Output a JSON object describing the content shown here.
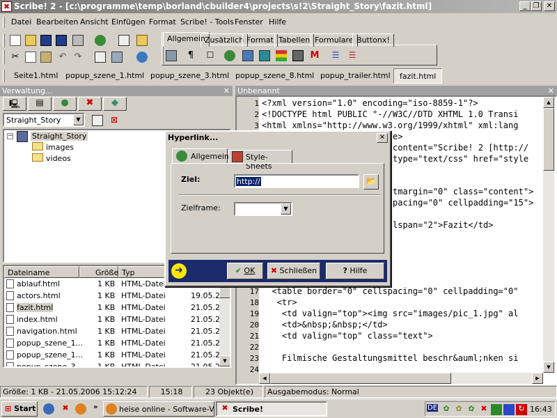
{
  "window": {
    "title": "Scribe! 2 - [c:\\programme\\temp\\borland\\cbuilder4\\projects\\s!2\\Straight_Story\\fazit.html]"
  },
  "menu": [
    "Datei",
    "Bearbeiten",
    "Ansicht",
    "Einfügen",
    "Format",
    "Scribe! - Tools",
    "Fenster",
    "Hilfe"
  ],
  "toolbar_tabs": [
    "Allgemein",
    "Zusätzlich",
    "Format",
    "Tabellen",
    "Formulare",
    "Buttonx!"
  ],
  "doc_tabs": [
    "Seite1.html",
    "popup_szene_1.html",
    "popup_szene_3.html",
    "popup_szene_8.html",
    "popup_trailer.html",
    "fazit.html"
  ],
  "left_panel": {
    "title": "Verwaltung...",
    "project_select": "Straight_Story",
    "tree": {
      "root": "Straight_Story",
      "children": [
        "images",
        "videos"
      ]
    },
    "columns": [
      "Dateiname",
      "Größe",
      "Typ"
    ],
    "files": [
      {
        "name": "ablauf.html",
        "size": "1 KB",
        "type": "HTML-Datei",
        "date": ""
      },
      {
        "name": "actors.html",
        "size": "1 KB",
        "type": "HTML-Datei",
        "date": "19.05.2"
      },
      {
        "name": "fazit.html",
        "size": "1 KB",
        "type": "HTML-Datei",
        "date": "21.05.2"
      },
      {
        "name": "index.html",
        "size": "1 KB",
        "type": "HTML-Datei",
        "date": "21.05.2"
      },
      {
        "name": "navigation.html",
        "size": "1 KB",
        "type": "HTML-Datei",
        "date": "21.05.2"
      },
      {
        "name": "popup_szene_1...",
        "size": "1 KB",
        "type": "HTML-Datei",
        "date": "21.05.2"
      },
      {
        "name": "popup_szene_1...",
        "size": "1 KB",
        "type": "HTML-Datei",
        "date": "21.05.2"
      },
      {
        "name": "popup_szene_3...",
        "size": "1 KB",
        "type": "HTML-Datei",
        "date": "21.05.2"
      }
    ]
  },
  "editor": {
    "title": "Unbenannt",
    "line_numbers": [
      "1",
      "2",
      "3",
      "17",
      "18",
      "19",
      "20",
      "21",
      "22",
      "23",
      "24"
    ],
    "lines_top": [
      "<?xml version=\"1.0\" encoding=\"iso-8859-1\"?>",
      "<!DOCTYPE html PUBLIC \"-//W3C//DTD XHTML 1.0 Transi",
      "<html xmlns=\"http://www.w3.org/1999/xhtml\" xml:lang"
    ],
    "lines_partial": [
      "e>",
      "content=\"Scribe! 2 [http://",
      "type=\"text/css\" href=\"style",
      "",
      "",
      "tmargin=\"0\" class=\"content\">",
      "pacing=\"0\" cellpadding=\"15\">",
      "",
      "lspan=\"2\">Fazit</td>"
    ],
    "lines_bottom": [
      "  <table border=\"0\" cellspacing=\"0\" cellpadding=\"0\"",
      "   <tr>",
      "    <td valign=\"top\"><img src=\"images/pic_1.jpg\" al",
      "    <td>&nbsp;&nbsp;</td>",
      "    <td valign=\"top\" class=\"text\">",
      "",
      "    Filmische Gestaltungsmittel beschr&auml;nken si",
      "    "
    ]
  },
  "dialog": {
    "title": "Hyperlink...",
    "tabs": [
      "Allgemein",
      "Style-Sheets"
    ],
    "ziel_label": "Ziel:",
    "ziel_value": "http://",
    "zielframe_label": "Zielframe:",
    "zielframe_value": "",
    "buttons": {
      "ok": "OK",
      "close": "Schließen",
      "help": "Hilfe"
    }
  },
  "statusbar": [
    "Größe: 1 KB - 21.05.2006 15:12:24",
    "15:18",
    "23 Objekt(e)",
    "Ausgabemodus: Normal"
  ],
  "taskbar": {
    "start": "Start",
    "tasks": [
      "heise online - Software-V...",
      "Scribe!"
    ],
    "lang": "DE",
    "clock": "16:43"
  }
}
